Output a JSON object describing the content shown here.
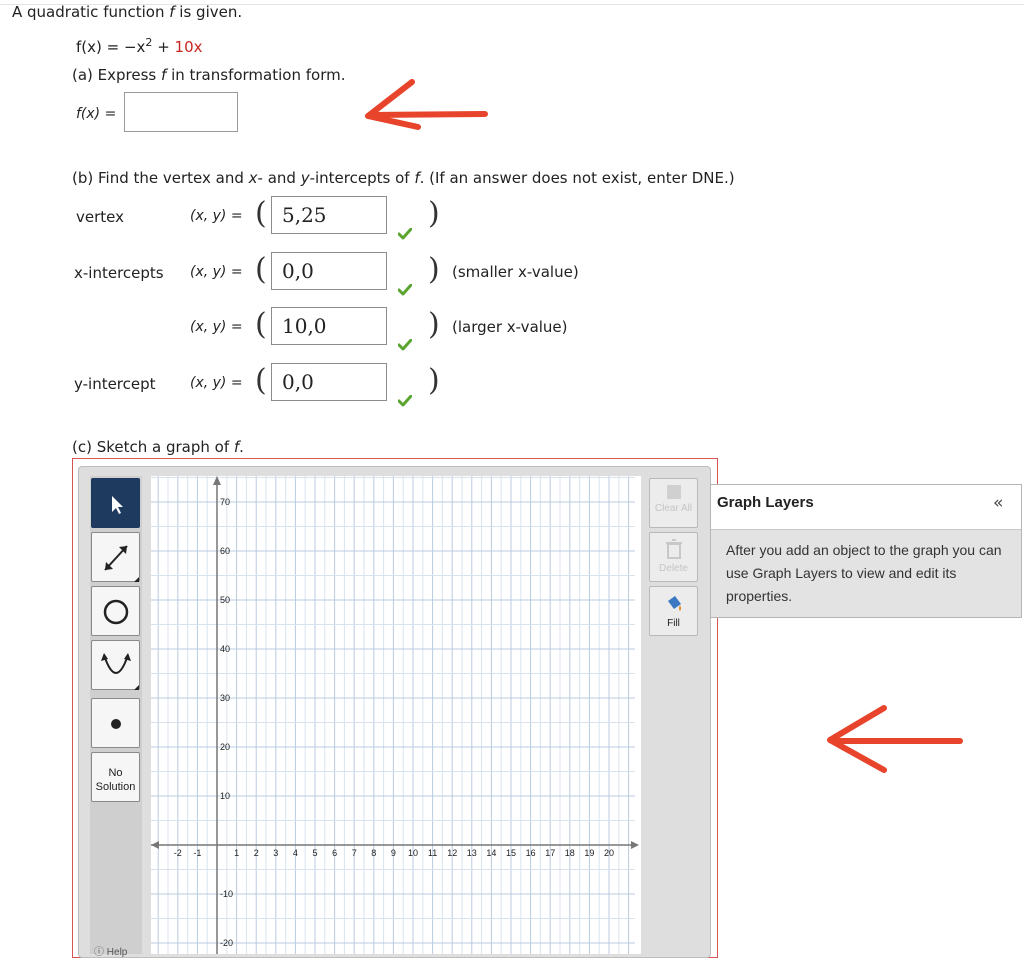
{
  "intro": {
    "lead": "A quadratic function ",
    "f": "f",
    "tail": " is given."
  },
  "function_def": {
    "lhs": "f(x) = −x",
    "exp": "2",
    "plus": " + ",
    "red_term": "10x"
  },
  "part_a": {
    "prompt_start": "(a) Express ",
    "f": "f",
    "prompt_end": " in transformation form.",
    "input_label": "f(x) =",
    "input_value": ""
  },
  "part_b": {
    "prompt_start": "(b) Find the vertex and ",
    "x": "x",
    "mid": "- and ",
    "y": "y",
    "mid2": "-intercepts of ",
    "f": "f",
    "prompt_end": ". (If an answer does not exist, enter DNE.)",
    "rows": [
      {
        "label": "vertex",
        "coord": "(x, y) =",
        "value": "5,25",
        "note": ""
      },
      {
        "label": "x-intercepts",
        "coord": "(x, y) =",
        "value": "0,0",
        "note": "(smaller x-value)"
      },
      {
        "label": "",
        "coord": "(x, y) =",
        "value": "10,0",
        "note": "(larger x-value)"
      },
      {
        "label": "y-intercept",
        "coord": "(x, y) =",
        "value": "0,0",
        "note": ""
      }
    ]
  },
  "part_c": {
    "prompt": "(c) Sketch a graph of ",
    "f": "f",
    "dot": "."
  },
  "tools": {
    "no_solution": [
      "No",
      "Solution"
    ],
    "help": "Help"
  },
  "right_tools": {
    "clear_all": "Clear All",
    "delete": "Delete",
    "fill": "Fill"
  },
  "layers": {
    "title": "Graph Layers",
    "collapse": "«",
    "body": "After you add an object to the graph you can use Graph Layers to view and edit its properties."
  },
  "graph": {
    "x_ticks": [
      "-2",
      "-1",
      "1",
      "2",
      "3",
      "4",
      "5",
      "6",
      "7",
      "8",
      "9",
      "10",
      "11",
      "12",
      "13",
      "14",
      "15",
      "16",
      "17",
      "18",
      "19",
      "20"
    ],
    "y_ticks": [
      "70",
      "60",
      "50",
      "40",
      "30",
      "20",
      "10",
      "-10",
      "-20"
    ]
  },
  "colors": {
    "accent_red": "#c8261e",
    "check_green": "#5aa530",
    "annotation_red": "#e8432b"
  }
}
